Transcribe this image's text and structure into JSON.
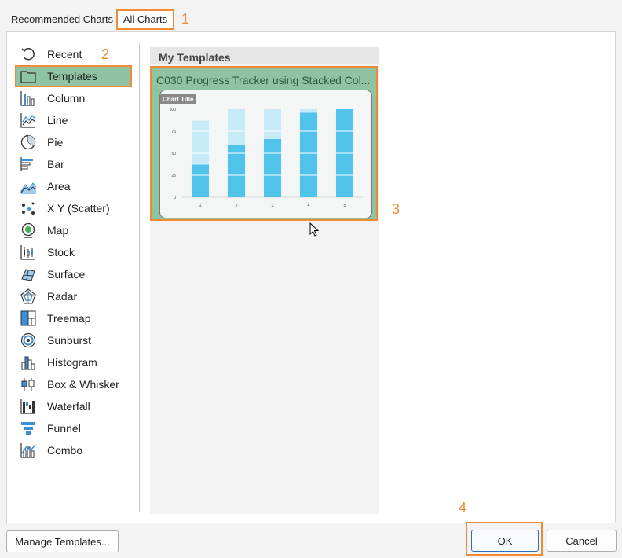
{
  "tabs": {
    "recommended": "Recommended Charts",
    "all": "All Charts"
  },
  "annotations": [
    "1",
    "2",
    "3",
    "4"
  ],
  "sidebar": {
    "items": [
      {
        "label": "Recent",
        "icon": "recent-icon"
      },
      {
        "label": "Templates",
        "icon": "folder-icon",
        "selected": true
      },
      {
        "label": "Column",
        "icon": "column-chart-icon"
      },
      {
        "label": "Line",
        "icon": "line-chart-icon"
      },
      {
        "label": "Pie",
        "icon": "pie-chart-icon"
      },
      {
        "label": "Bar",
        "icon": "bar-chart-icon"
      },
      {
        "label": "Area",
        "icon": "area-chart-icon"
      },
      {
        "label": "X Y (Scatter)",
        "icon": "scatter-chart-icon"
      },
      {
        "label": "Map",
        "icon": "map-chart-icon"
      },
      {
        "label": "Stock",
        "icon": "stock-chart-icon"
      },
      {
        "label": "Surface",
        "icon": "surface-chart-icon"
      },
      {
        "label": "Radar",
        "icon": "radar-chart-icon"
      },
      {
        "label": "Treemap",
        "icon": "treemap-chart-icon"
      },
      {
        "label": "Sunburst",
        "icon": "sunburst-chart-icon"
      },
      {
        "label": "Histogram",
        "icon": "histogram-chart-icon"
      },
      {
        "label": "Box & Whisker",
        "icon": "box-whisker-chart-icon"
      },
      {
        "label": "Waterfall",
        "icon": "waterfall-chart-icon"
      },
      {
        "label": "Funnel",
        "icon": "funnel-chart-icon"
      },
      {
        "label": "Combo",
        "icon": "combo-chart-icon"
      }
    ]
  },
  "content": {
    "heading": "My Templates",
    "template": {
      "title": "C030 Progress Tracker using Stacked Col...",
      "thumbnail": {
        "chart_title": "Chart Title",
        "type": "stacked-bar",
        "y_ticks": [
          "100",
          "75",
          "50",
          "25",
          "0"
        ],
        "ylim": [
          0,
          100
        ],
        "categories": [
          "1",
          "2",
          "3",
          "4",
          "5"
        ],
        "progress": [
          37,
          59,
          66,
          96,
          100
        ],
        "total": [
          87,
          100,
          100,
          100,
          100
        ],
        "colors": {
          "progress": "#4fc3ea",
          "remaining": "#c7eaf8"
        }
      }
    }
  },
  "footer": {
    "manage_label": "Manage Templates...",
    "ok_label": "OK",
    "cancel_label": "Cancel"
  },
  "colors": {
    "accent": "#f08a34",
    "selected_bg": "#8fc3a1"
  }
}
